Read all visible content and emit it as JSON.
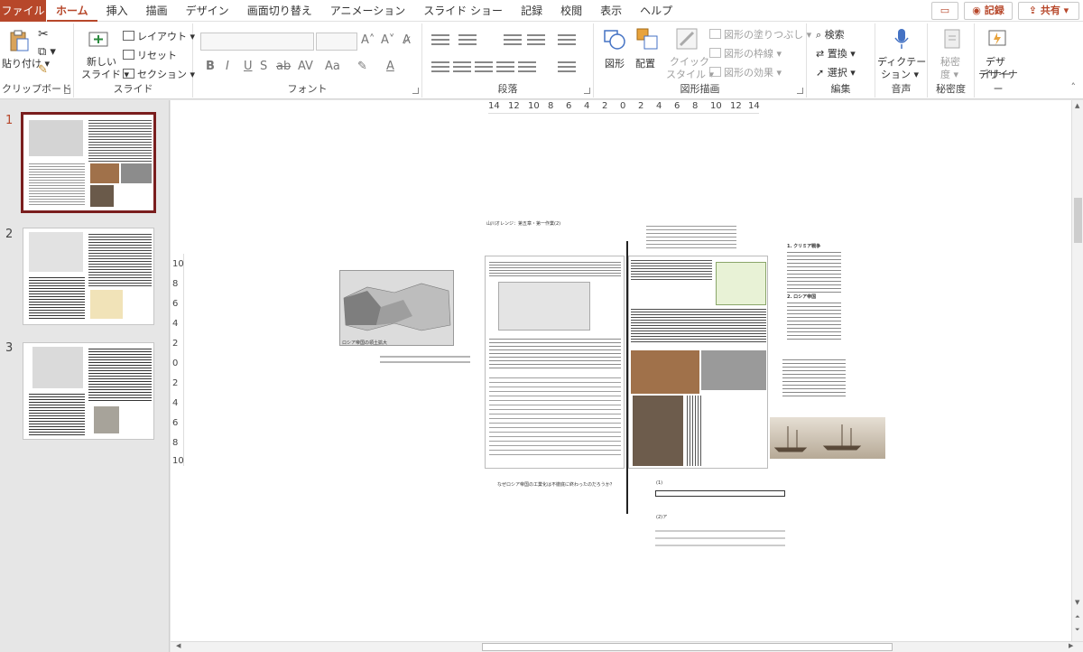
{
  "menubar": {
    "file": "ファイル",
    "tabs": [
      "ホーム",
      "挿入",
      "描画",
      "デザイン",
      "画面切り替え",
      "アニメーション",
      "スライド ショー",
      "記録",
      "校閲",
      "表示",
      "ヘルプ"
    ],
    "record": "記録",
    "share": "共有"
  },
  "ribbon": {
    "clipboard": {
      "paste": "貼り付け",
      "label": "クリップボード"
    },
    "slides": {
      "new_slide_1": "新しい",
      "new_slide_2": "スライド",
      "layout": "レイアウト",
      "reset": "リセット",
      "section": "セクション",
      "label": "スライド"
    },
    "font": {
      "label": "フォント"
    },
    "paragraph": {
      "label": "段落"
    },
    "drawing": {
      "shape": "図形",
      "arrange": "配置",
      "quick_1": "クイック",
      "quick_2": "スタイル",
      "fill": "図形の塗りつぶし",
      "outline": "図形の枠線",
      "effect": "図形の効果",
      "label": "図形描画"
    },
    "editing": {
      "find": "検索",
      "replace": "置換",
      "select": "選択",
      "label": "編集"
    },
    "voice": {
      "dictate_1": "ディクテー",
      "dictate_2": "ション",
      "label": "音声"
    },
    "sensitivity": {
      "btn_1": "秘密",
      "btn_2": "度",
      "label": "秘密度"
    },
    "designer": {
      "btn_1": "デザ",
      "btn_2": "イナー",
      "label": "デザイナー"
    }
  },
  "thumbnails": [
    "1",
    "2",
    "3"
  ],
  "rulers": {
    "h": [
      "14",
      "12",
      "10",
      "8",
      "6",
      "4",
      "2",
      "0",
      "2",
      "4",
      "6",
      "8",
      "10",
      "12",
      "14"
    ],
    "v": [
      "10",
      "8",
      "6",
      "4",
      "2",
      "0",
      "2",
      "4",
      "6",
      "8",
      "10"
    ]
  },
  "slide": {
    "q_title": "なぜロシア帝国の工業化は不徹底に終わったのだろうか？",
    "top_heading": "山川オレンジ：第五章・第一作業(2)",
    "answer_1": "(1)",
    "answer_2": "(2)ア",
    "notes_heading_1": "1. クリミア戦争",
    "notes_heading_2": "2. ロシア帝国",
    "map_legend": "ロシア帝国の領土拡大"
  },
  "colors": {
    "accent": "#b7472a",
    "slide_border": "#7a1e1e"
  }
}
